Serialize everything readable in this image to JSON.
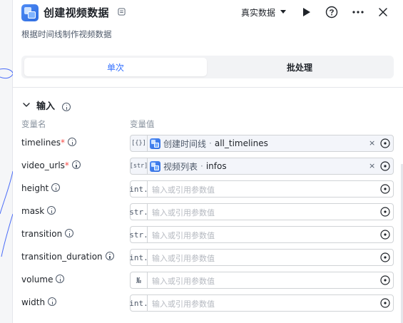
{
  "header": {
    "title": "创建视频数据",
    "mode_label": "真实数据",
    "description": "根据时间线制作视频数据"
  },
  "tabs": [
    {
      "label": "单次",
      "active": true
    },
    {
      "label": "批处理",
      "active": false
    }
  ],
  "section": {
    "title": "输入",
    "col_name": "变量名",
    "col_value": "变量值"
  },
  "params": [
    {
      "name": "timelines",
      "required": true,
      "type_tag": "[{}]",
      "kind": "reference",
      "ref_node": "创建时间线",
      "ref_var": "all_timelines"
    },
    {
      "name": "video_urls",
      "required": true,
      "type_tag": "[str]",
      "kind": "reference",
      "ref_node": "视频列表",
      "ref_var": "infos"
    },
    {
      "name": "height",
      "required": false,
      "type_tag": "int.",
      "kind": "input",
      "placeholder": "输入或引用参数值"
    },
    {
      "name": "mask",
      "required": false,
      "type_tag": "str.",
      "kind": "input",
      "placeholder": "输入或引用参数值"
    },
    {
      "name": "transition",
      "required": false,
      "type_tag": "str.",
      "kind": "input",
      "placeholder": "输入或引用参数值"
    },
    {
      "name": "transition_duration",
      "required": false,
      "type_tag": "int.",
      "kind": "input",
      "placeholder": "输入或引用参数值"
    },
    {
      "name": "volume",
      "required": false,
      "type_tag": "№",
      "kind": "input",
      "placeholder": "输入或引用参数值"
    },
    {
      "name": "width",
      "required": false,
      "type_tag": "int.",
      "kind": "input",
      "placeholder": "输入或引用参数值"
    }
  ],
  "colors": {
    "accent": "#3370ff",
    "required": "#f54a45",
    "node_icon": "#2f6de0"
  },
  "icons": {
    "node": "video-node-icon",
    "title_tag": "tag-icon",
    "mode_caret": "caret-down-icon",
    "run": "play-icon",
    "help": "help-icon",
    "more": "more-icon",
    "close": "close-icon",
    "collapse": "chevron-down-icon",
    "info": "info-icon",
    "variable": "variable-icon"
  }
}
